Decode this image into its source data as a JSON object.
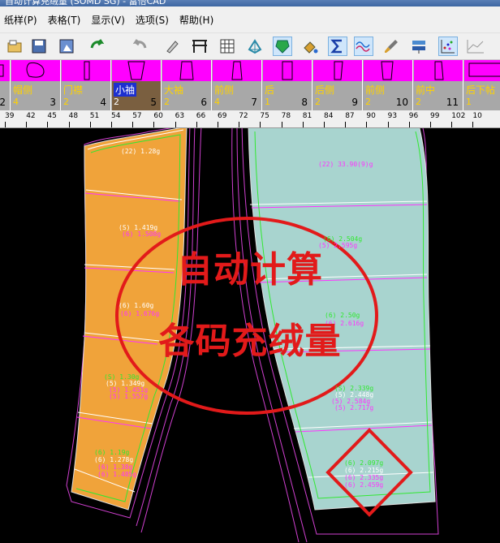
{
  "window": {
    "title": "自动计算充绒量 (SOMD SG) - 富怡CAD"
  },
  "menu": [
    {
      "label": "纸样(P)"
    },
    {
      "label": "表格(T)"
    },
    {
      "label": "显示(V)"
    },
    {
      "label": "选项(S)"
    },
    {
      "label": "帮助(H)"
    }
  ],
  "toolbar": {
    "icons": [
      "open-icon",
      "save-icon",
      "save-as-icon",
      "undo-icon",
      "redo-icon",
      "pen-icon",
      "frame-icon",
      "grid-icon",
      "polygon-icon",
      "shield-icon",
      "fill-icon",
      "sigma-icon",
      "wave-icon",
      "brush-icon",
      "layers-icon",
      "scatter-icon",
      "chart-icon"
    ]
  },
  "pieces": [
    {
      "name": "",
      "qty": "2",
      "idx": "2"
    },
    {
      "name": "帽侧",
      "qty": "4",
      "idx": "3"
    },
    {
      "name": "门襟",
      "qty": "2",
      "idx": "4"
    },
    {
      "name": "小袖",
      "qty": "2",
      "idx": "5",
      "selected": true
    },
    {
      "name": "大袖",
      "qty": "2",
      "idx": "6"
    },
    {
      "name": "前侧",
      "qty": "4",
      "idx": "7"
    },
    {
      "name": "后",
      "qty": "1",
      "idx": "8"
    },
    {
      "name": "后侧",
      "qty": "2",
      "idx": "9"
    },
    {
      "name": "前侧",
      "qty": "2",
      "idx": "10"
    },
    {
      "name": "前中",
      "qty": "2",
      "idx": "11"
    },
    {
      "name": "后下帖",
      "qty": "1",
      "idx": "1"
    }
  ],
  "ruler": [
    "39",
    "42",
    "45",
    "48",
    "51",
    "54",
    "57",
    "60",
    "63",
    "66",
    "69",
    "72",
    "75",
    "78",
    "81",
    "84",
    "87",
    "90",
    "93",
    "96",
    "99",
    "102",
    "10"
  ],
  "left_piece_labels": [
    {
      "t": "(22) 1.28g",
      "c": "w"
    },
    {
      "t": "(S) 1.419g",
      "c": "w"
    },
    {
      "t": "(6) 1.508g",
      "c": "m"
    },
    {
      "t": "(6) 1.60g",
      "c": "w"
    },
    {
      "t": "(6) 1.676g",
      "c": "m"
    },
    {
      "t": "(S) 1.30g",
      "c": "g"
    },
    {
      "t": "(5) 1.349g",
      "c": "w"
    },
    {
      "t": "(5) 1.451g",
      "c": "m"
    },
    {
      "t": "(5) 1.557g",
      "c": "m"
    },
    {
      "t": "(6) 1.19g",
      "c": "g"
    },
    {
      "t": "(6) 1.278g",
      "c": "w"
    },
    {
      "t": "(6) 1.38g",
      "c": "m"
    },
    {
      "t": "(6) 1.485g",
      "c": "m"
    }
  ],
  "right_piece_labels": [
    {
      "t": "(22) 33.90(9)g",
      "c": "m"
    },
    {
      "t": "(6) 2.504g",
      "c": "g"
    },
    {
      "t": "(5) 2.595g",
      "c": "m"
    },
    {
      "t": "(6) 2.50g",
      "c": "g"
    },
    {
      "t": "(6) 2.616g",
      "c": "m"
    },
    {
      "t": "(S) 2.339g",
      "c": "g"
    },
    {
      "t": "(5) 2.448g",
      "c": "w"
    },
    {
      "t": "(5) 2.584g",
      "c": "m"
    },
    {
      "t": "(5) 2.717g",
      "c": "m"
    },
    {
      "t": "(6) 2.097g",
      "c": "g"
    },
    {
      "t": "(6) 2.215g",
      "c": "w"
    },
    {
      "t": "(6) 2.335g",
      "c": "m"
    },
    {
      "t": "(6) 2.459g",
      "c": "m"
    }
  ],
  "overlay": {
    "line1": "自动计算",
    "line2": "各码充绒量"
  },
  "colors": {
    "left_piece": "#f0a33a",
    "right_piece": "#a8d4cf",
    "accent_red": "#e21a1a",
    "selection_band": "#ff00ff"
  }
}
